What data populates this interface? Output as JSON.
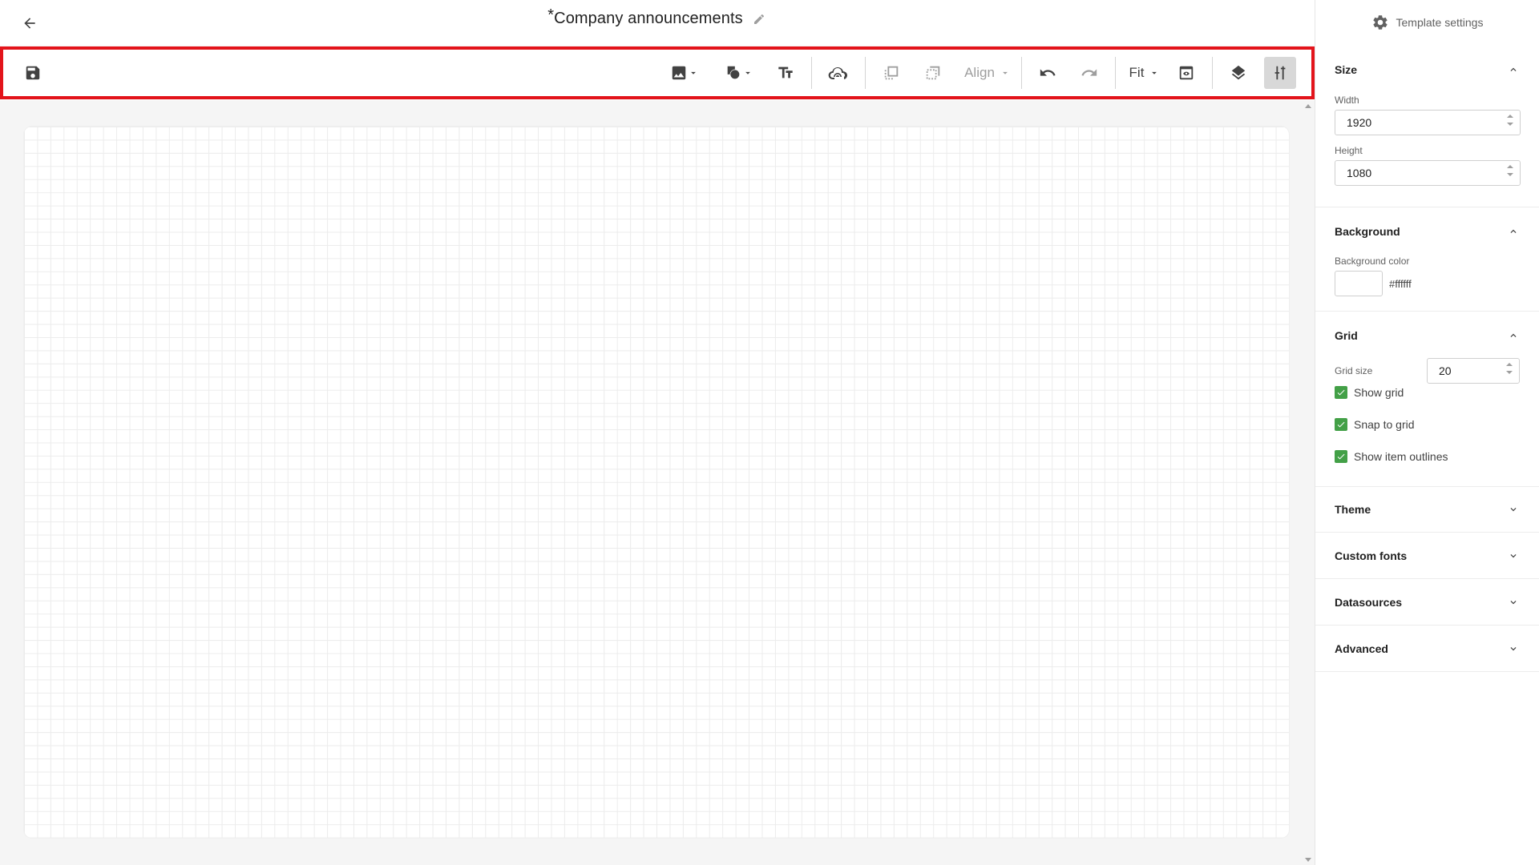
{
  "header": {
    "title_prefix": "*",
    "title": "Company announcements"
  },
  "toolbar": {
    "align_label": "Align",
    "zoom_label": "Fit"
  },
  "panel": {
    "header_label": "Template settings",
    "size": {
      "title": "Size",
      "width_label": "Width",
      "width_value": "1920",
      "height_label": "Height",
      "height_value": "1080"
    },
    "background": {
      "title": "Background",
      "color_label": "Background color",
      "color_value": "#ffffff"
    },
    "grid": {
      "title": "Grid",
      "size_label": "Grid size",
      "size_value": "20",
      "show_grid": "Show grid",
      "snap_to_grid": "Snap to grid",
      "show_outlines": "Show item outlines"
    },
    "theme": {
      "title": "Theme"
    },
    "custom_fonts": {
      "title": "Custom fonts"
    },
    "datasources": {
      "title": "Datasources"
    },
    "advanced": {
      "title": "Advanced"
    }
  },
  "colors": {
    "highlight_border": "#e3141b",
    "checkbox_green": "#43a047"
  }
}
